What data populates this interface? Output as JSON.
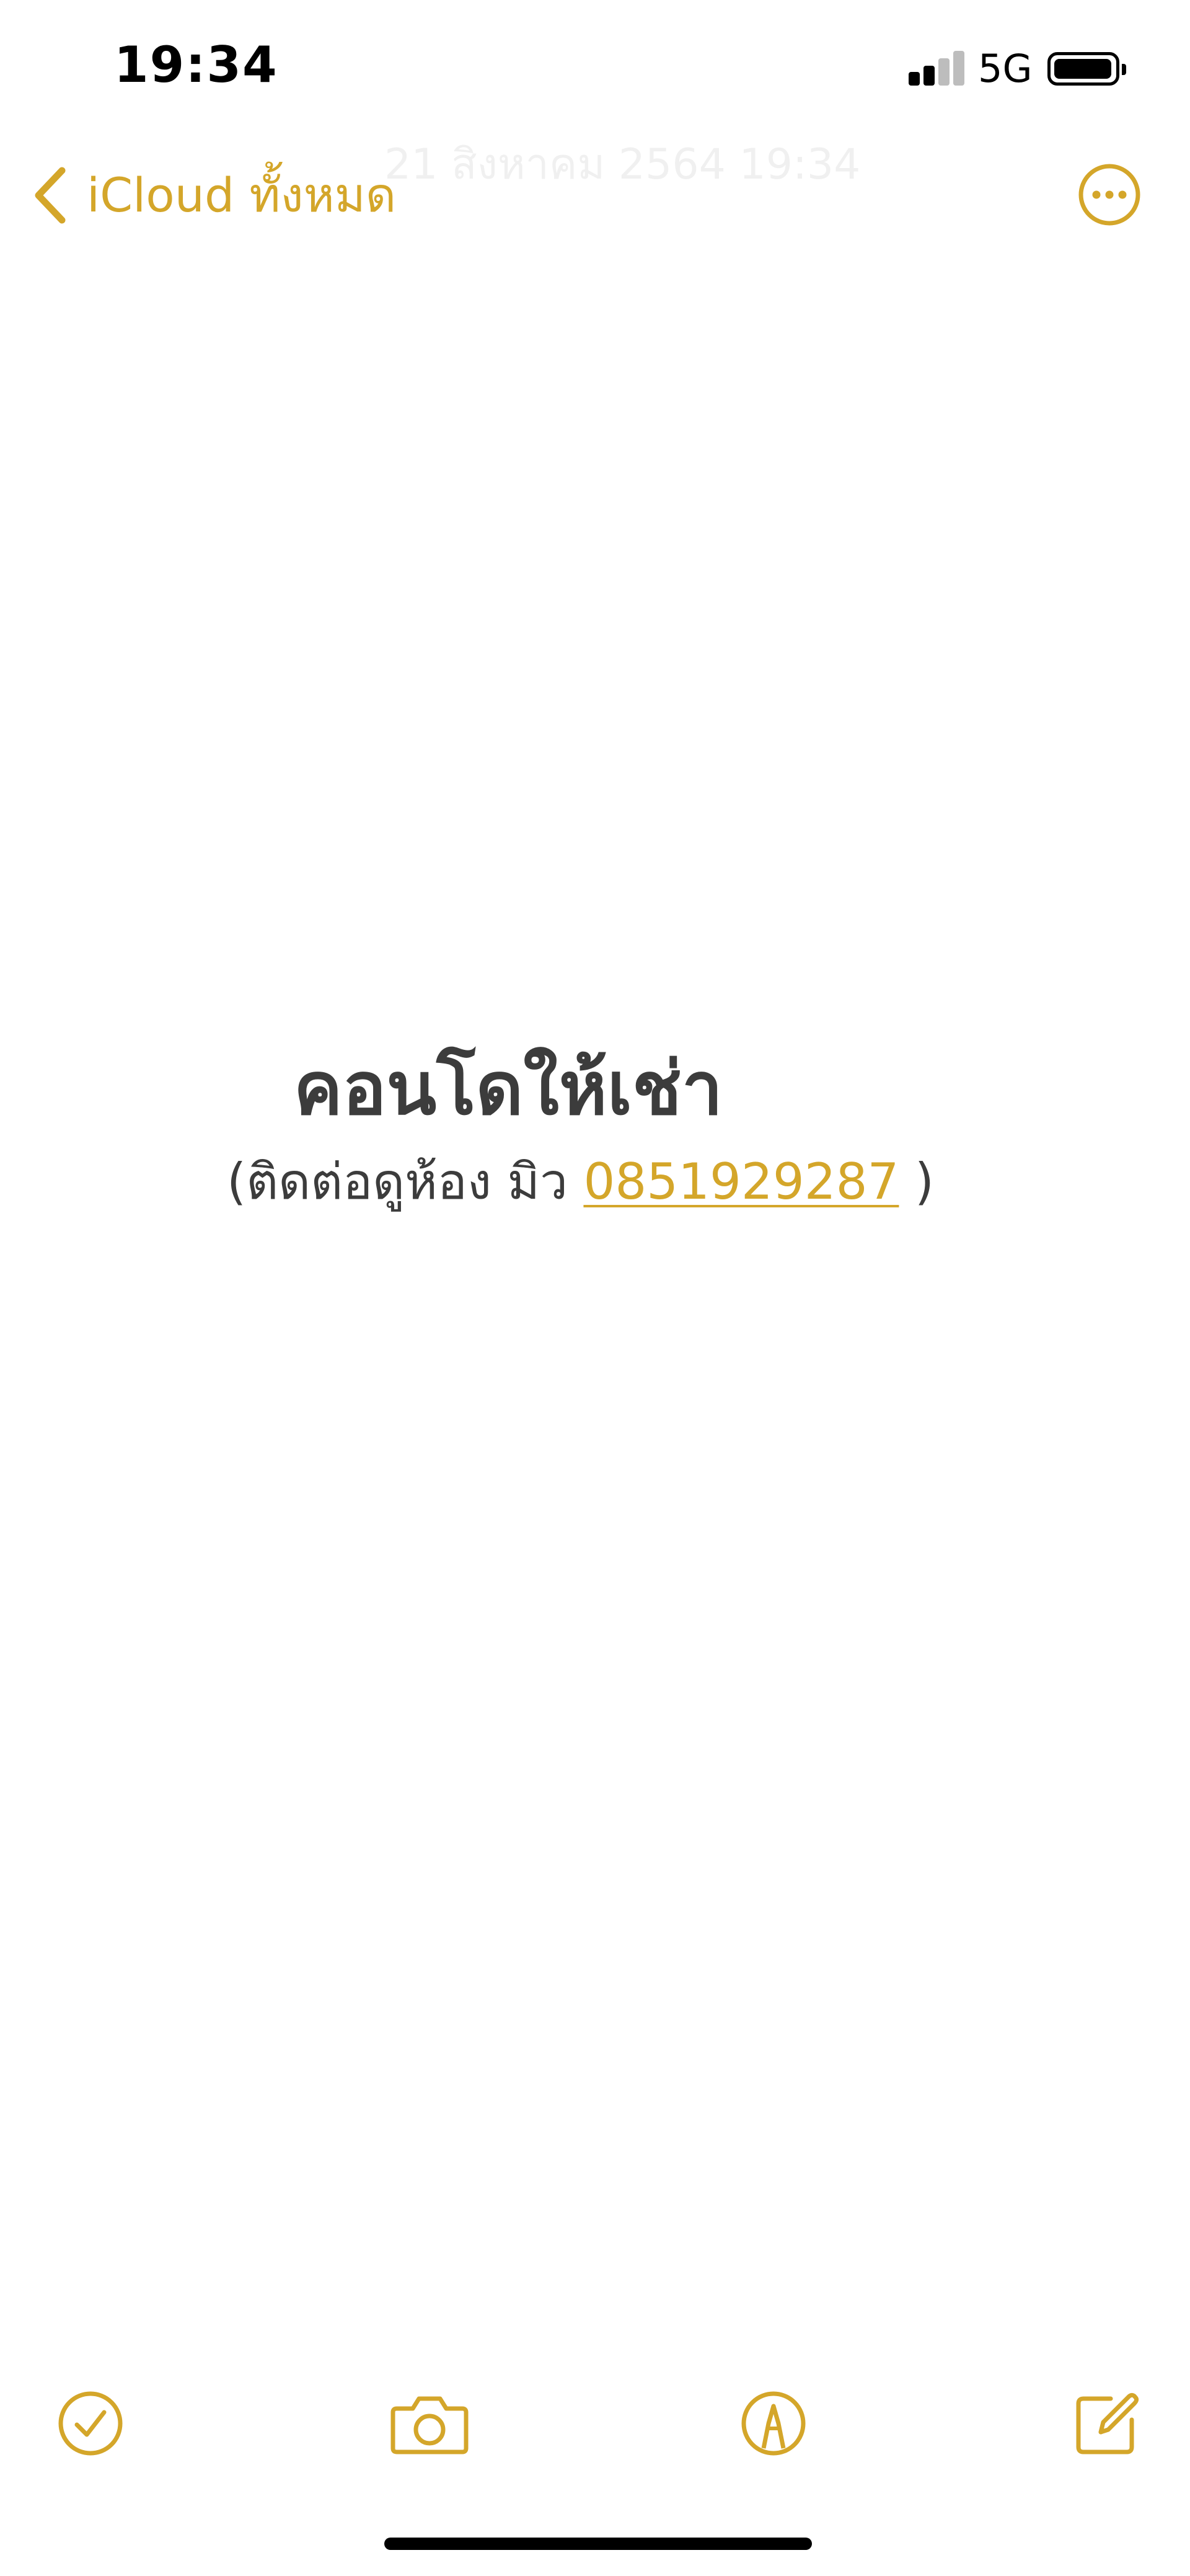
{
  "status_bar": {
    "time": "19:34",
    "network": "5G"
  },
  "nav": {
    "back_label": "iCloud ทั้งหมด",
    "faded_date": "21 สิงหาคม 2564 19:34"
  },
  "note": {
    "title": "คอนโดให้เช่า",
    "contact_prefix": "(ติดต่อดูห้อง  มิว ",
    "phone": "0851929287",
    "contact_suffix": " )"
  },
  "icons": {
    "back": "chevron-left-icon",
    "more": "ellipsis-circle-icon",
    "checklist": "checkmark-circle-icon",
    "camera": "camera-icon",
    "markup": "pen-tip-circle-icon",
    "compose": "compose-icon"
  },
  "colors": {
    "accent": "#d4a62a",
    "text": "#3c3c3c",
    "background": "#ffffff"
  }
}
